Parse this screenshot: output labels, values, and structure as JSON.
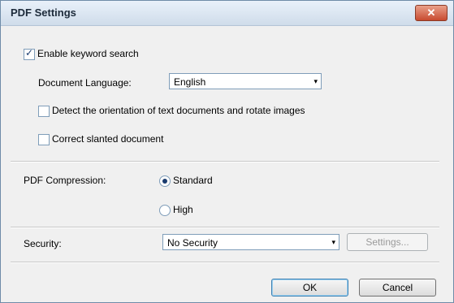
{
  "window": {
    "title": "PDF Settings",
    "close_glyph": "✕"
  },
  "keyword_search": {
    "label": "Enable keyword search",
    "checked": true
  },
  "document_language": {
    "label": "Document Language:",
    "value": "English"
  },
  "detect_orientation": {
    "label": "Detect the orientation of text documents and rotate images",
    "checked": false
  },
  "correct_slanted": {
    "label": "Correct slanted document",
    "checked": false
  },
  "compression": {
    "label": "PDF Compression:",
    "options": [
      {
        "label": "Standard",
        "selected": true
      },
      {
        "label": "High",
        "selected": false
      }
    ]
  },
  "security": {
    "label": "Security:",
    "value": "No Security",
    "settings_label": "Settings..."
  },
  "buttons": {
    "ok": "OK",
    "cancel": "Cancel"
  },
  "icons": {
    "dropdown": "▾"
  }
}
